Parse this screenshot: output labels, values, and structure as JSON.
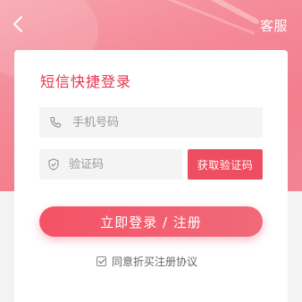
{
  "header": {
    "service_label": "客服",
    "back_icon": "chevron-left-icon"
  },
  "login": {
    "title": "短信快捷登录",
    "phone_placeholder": "手机号码",
    "phone_icon": "phone-icon",
    "code_placeholder": "验证码",
    "code_icon": "shield-check-icon",
    "get_code_label": "获取验证码",
    "submit_label": "立即登录 / 注册",
    "agreement_checked": true,
    "agreement_label": "同意折买注册协议"
  },
  "colors": {
    "accent": "#ee4e61",
    "title": "#e8344e",
    "hero": "#f58a98"
  }
}
